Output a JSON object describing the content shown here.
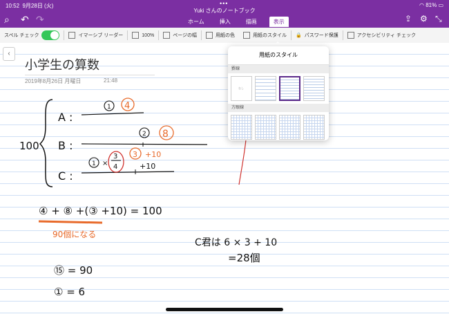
{
  "status": {
    "time": "10:52",
    "date": "9月28日 (火)",
    "battery": "81%"
  },
  "window_title": "Yuki さんのノートブック",
  "tabs": [
    {
      "label": "ホーム"
    },
    {
      "label": "挿入"
    },
    {
      "label": "描画"
    },
    {
      "label": "表示"
    }
  ],
  "ribbon": {
    "spell_check": "スペル チェック",
    "immersive_reader": "イマーシブ リーダー",
    "zoom": "100%",
    "page_width": "ページの幅",
    "paper_color": "用紙の色",
    "paper_style": "用紙のスタイル",
    "password": "パスワード保護",
    "accessibility": "アクセシビリティ チェック"
  },
  "page": {
    "title": "小学生の算数",
    "date": "2019年8月26日 月曜日",
    "time": "21:48"
  },
  "popover": {
    "title": "用紙のスタイル",
    "section_ruled": "罫線",
    "section_grid": "方眼線",
    "blank_label": "なし"
  },
  "ink": {
    "A": "A :",
    "B": "B :",
    "C": "C :",
    "hundred": "100",
    "c1": "①",
    "four": "4",
    "c2": "②",
    "eight": "8",
    "x": "×",
    "three_fourths": "3/4",
    "three": "3",
    "plus10": "+10",
    "eq_line": "④ + ⑧ +(③ +10) = 100",
    "ninety_note": "90個になる",
    "c_note": "C君は 6 × 3 + 10",
    "c_result": "=28個",
    "fifteen": "⑮ = 90",
    "one": "① = 6"
  },
  "colors": {
    "accent": "#7b2fa2",
    "toggle": "#34c759",
    "ink_orange": "#e86a2a",
    "ink_red": "#d0312d"
  }
}
